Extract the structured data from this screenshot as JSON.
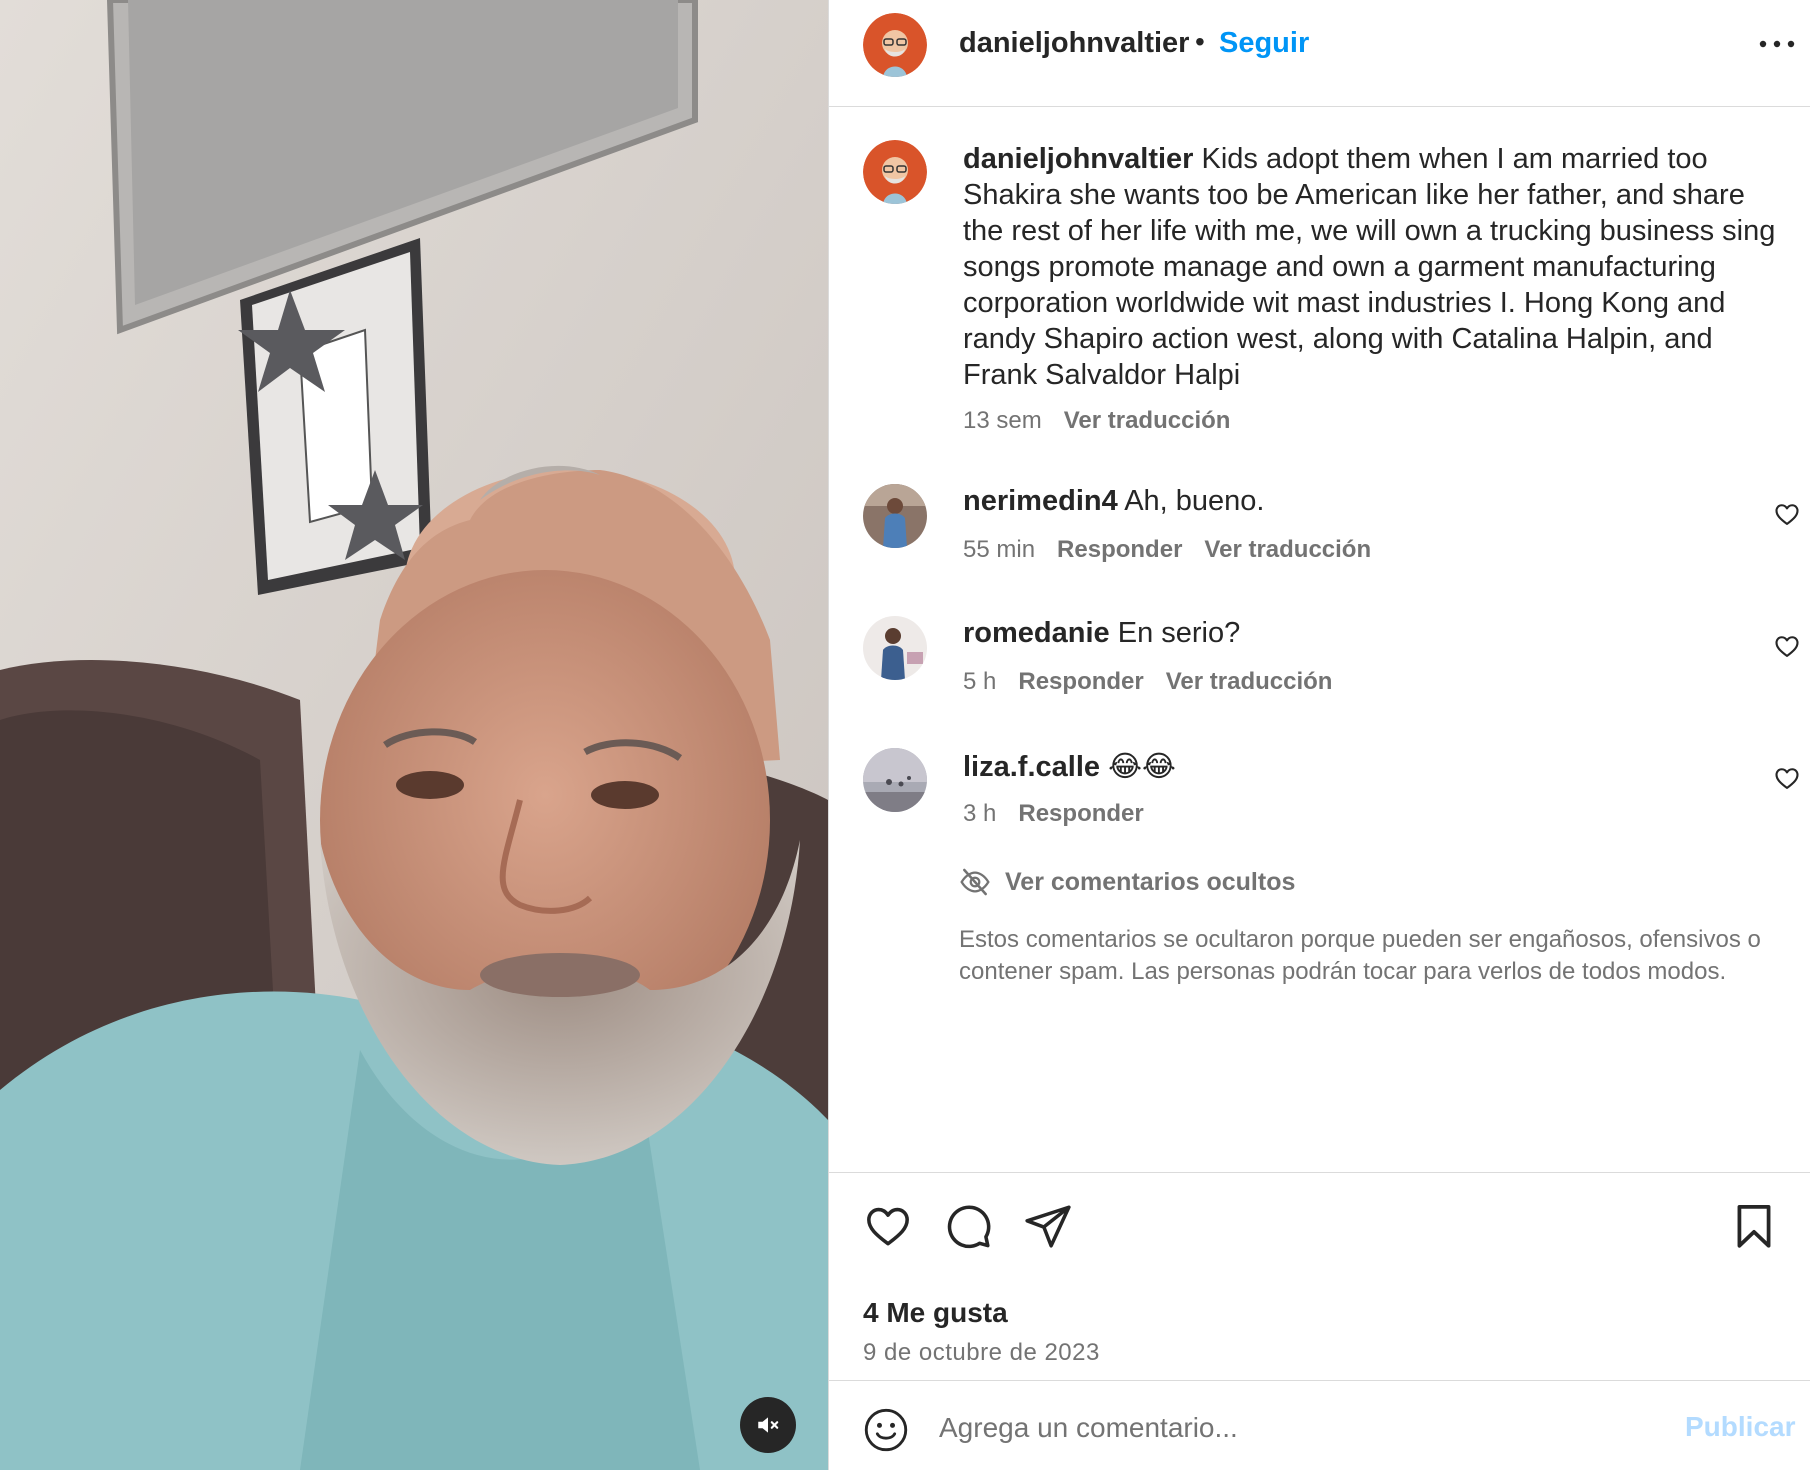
{
  "post": {
    "username": "danieljohnvaltier",
    "follow_label": "Seguir",
    "separator": "•",
    "more_icon": "more-horizontal-icon",
    "mute_icon": "speaker-muted-icon"
  },
  "caption": {
    "username": "danieljohnvaltier",
    "text": "Kids adopt them when I am married too Shakira she wants too be American like her father, and share the rest of her life with me, we will own a trucking business sing songs promote manage and own a garment manufacturing corporation worldwide wit mast industries I. Hong Kong and randy Shapiro action west, along with Catalina Halpin, and Frank Salvaldor Halpi",
    "time": "13 sem",
    "translate_label": "Ver traducción"
  },
  "comments": [
    {
      "username": "nerimedin4",
      "text": "Ah, bueno.",
      "time": "55 min",
      "reply_label": "Responder",
      "translate_label": "Ver traducción"
    },
    {
      "username": "romedanie",
      "text": "En serio?",
      "time": "5 h",
      "reply_label": "Responder",
      "translate_label": "Ver traducción"
    },
    {
      "username": "liza.f.calle",
      "text": "😂😂",
      "time": "3 h",
      "reply_label": "Responder",
      "translate_label": ""
    }
  ],
  "hidden_comments": {
    "label": "Ver comentarios ocultos",
    "note": "Estos comentarios se ocultaron porque pueden ser engañosos, ofensivos o contener spam. Las personas podrán tocar para verlos de todos modos."
  },
  "actions": {
    "likes": "4 Me gusta",
    "date": "9 de octubre de 2023",
    "icons": [
      "heart-icon",
      "comment-icon",
      "share-icon",
      "bookmark-icon"
    ]
  },
  "composer": {
    "placeholder": "Agrega un comentario...",
    "publish_label": "Publicar"
  },
  "colors": {
    "link_blue": "#0095f6",
    "publish_disabled": "#b3dbff",
    "secondary_text": "#737373",
    "divider": "#dbdbdb"
  }
}
